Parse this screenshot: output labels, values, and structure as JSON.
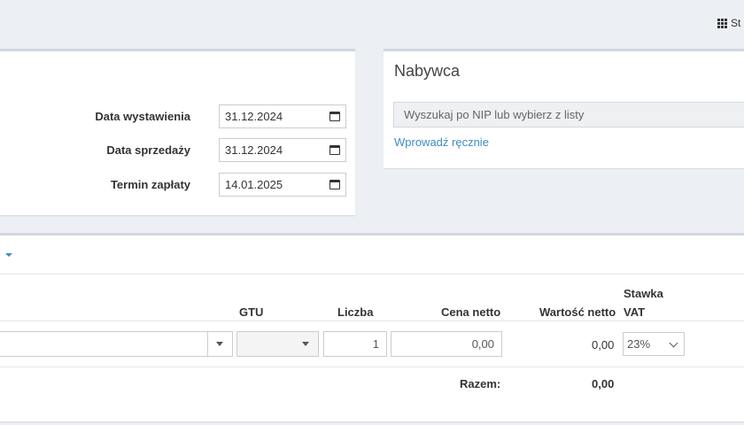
{
  "topbar": {
    "settings_fragment": "St"
  },
  "dates_panel": {
    "issue_date": {
      "label": "Data wystawienia",
      "value": "31.12.2024"
    },
    "sale_date": {
      "label": "Data sprzedaży",
      "value": "31.12.2024"
    },
    "due_date": {
      "label": "Termin zapłaty",
      "value": "14.01.2025"
    }
  },
  "buyer_panel": {
    "title": "Nabywca",
    "search_placeholder": "Wyszukaj po NIP lub wybierz z listy",
    "manual_link": "Wprowadź ręcznie"
  },
  "items_table": {
    "headers": {
      "gtu": "GTU",
      "quantity": "Liczba",
      "net_price": "Cena netto",
      "net_value": "Wartość netto",
      "vat_rate_line1": "Stawka",
      "vat_rate_line2": "VAT"
    },
    "row": {
      "quantity": "1",
      "net_price": "0,00",
      "net_value": "0,00",
      "vat_rate": "23%"
    },
    "total_label": "Razem:",
    "total_value": "0,00"
  },
  "colors": {
    "accent": "#3c8dbc",
    "background": "#ecf0f5"
  }
}
